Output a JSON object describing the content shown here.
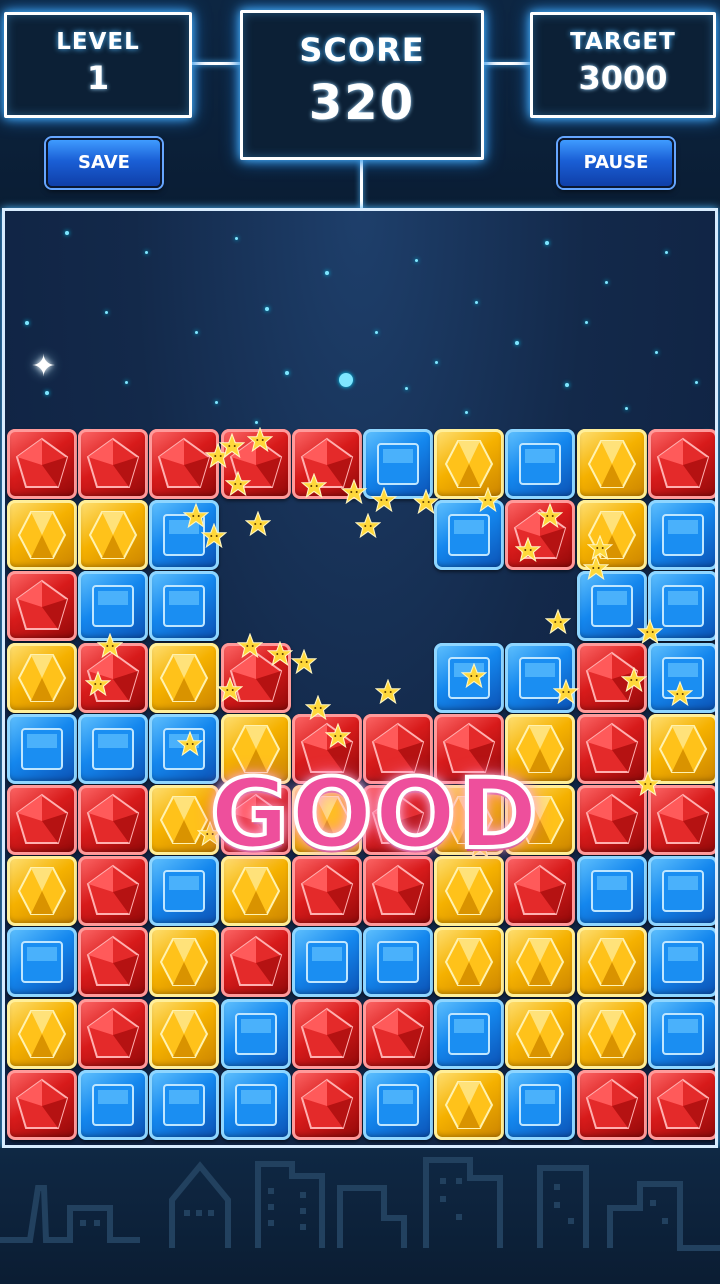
{
  "header": {
    "level": {
      "label": "LEVEL",
      "value": "1"
    },
    "score": {
      "label": "SCORE",
      "value": "320"
    },
    "target": {
      "label": "TARGET",
      "value": "3000"
    },
    "save_label": "SAVE",
    "pause_label": "PAUSE"
  },
  "board": {
    "columns": 10,
    "rows": 10,
    "grid": [
      [
        "red",
        "red",
        "red",
        "red",
        "red",
        "blue",
        "yellow",
        "blue",
        "yellow",
        "red"
      ],
      [
        "yellow",
        "yellow",
        "blue",
        "",
        "",
        "",
        "blue",
        "red",
        "yellow",
        "blue"
      ],
      [
        "red",
        "blue",
        "blue",
        "",
        "",
        "",
        "",
        "",
        "blue",
        "blue"
      ],
      [
        "yellow",
        "red",
        "yellow",
        "red",
        "",
        "",
        "blue",
        "blue",
        "red",
        "blue"
      ],
      [
        "blue",
        "blue",
        "blue",
        "yellow",
        "red",
        "red",
        "red",
        "yellow",
        "red",
        "yellow"
      ],
      [
        "red",
        "red",
        "yellow",
        "red",
        "yellow",
        "red",
        "yellow",
        "yellow",
        "red",
        "red"
      ],
      [
        "yellow",
        "red",
        "blue",
        "yellow",
        "red",
        "red",
        "yellow",
        "red",
        "blue",
        "blue"
      ],
      [
        "blue",
        "red",
        "yellow",
        "red",
        "blue",
        "blue",
        "yellow",
        "yellow",
        "yellow",
        "blue"
      ],
      [
        "yellow",
        "red",
        "yellow",
        "blue",
        "red",
        "red",
        "blue",
        "yellow",
        "yellow",
        "blue"
      ],
      [
        "red",
        "blue",
        "blue",
        "blue",
        "red",
        "blue",
        "yellow",
        "blue",
        "red",
        "red"
      ]
    ]
  },
  "overlay": {
    "text": "GOOD"
  },
  "colors": {
    "background": "#0b1f37",
    "panel_glow": "#4fb8ff",
    "red_gem": "#d81b1b",
    "blue_gem": "#1487ee",
    "yellow_gem": "#f5b100",
    "good_text": "#ee4f9c"
  }
}
